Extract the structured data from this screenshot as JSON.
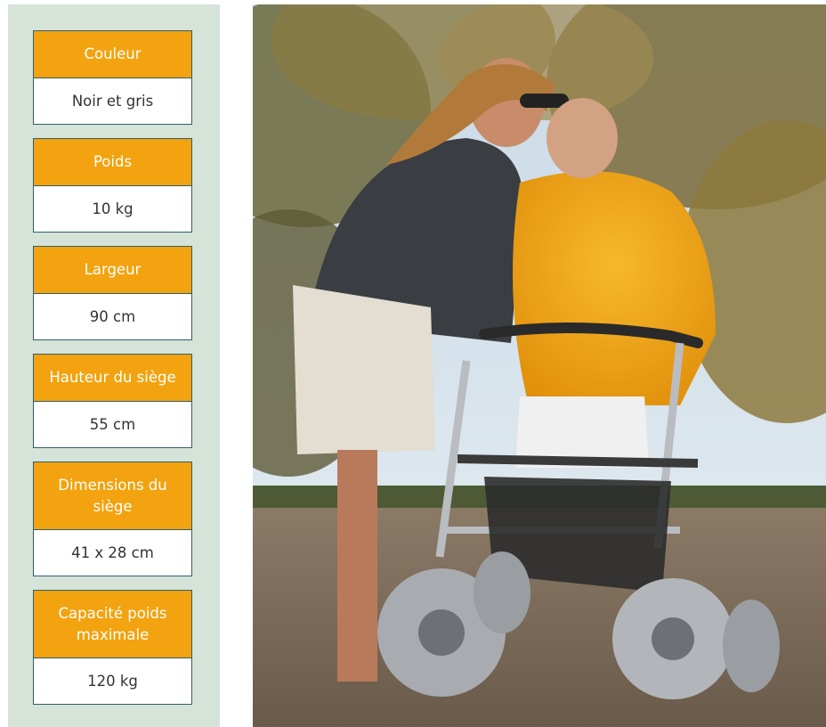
{
  "specs": [
    {
      "label": "Couleur",
      "value": "Noir et gris"
    },
    {
      "label": "Poids",
      "value": "10 kg"
    },
    {
      "label": "Largeur",
      "value": "90 cm"
    },
    {
      "label": "Hauteur du siège",
      "value": "55 cm"
    },
    {
      "label": "Dimensions du siège",
      "value": "41 x 28 cm"
    },
    {
      "label": "Capacité poids maximale",
      "value": "120 kg"
    }
  ],
  "colors": {
    "panel_bg": "#d6e3d9",
    "label_bg": "#f2a30f",
    "border": "#2f5f6a"
  },
  "photo": {
    "subject": "beach walker with balloon wheels",
    "icon": "photo-image"
  }
}
